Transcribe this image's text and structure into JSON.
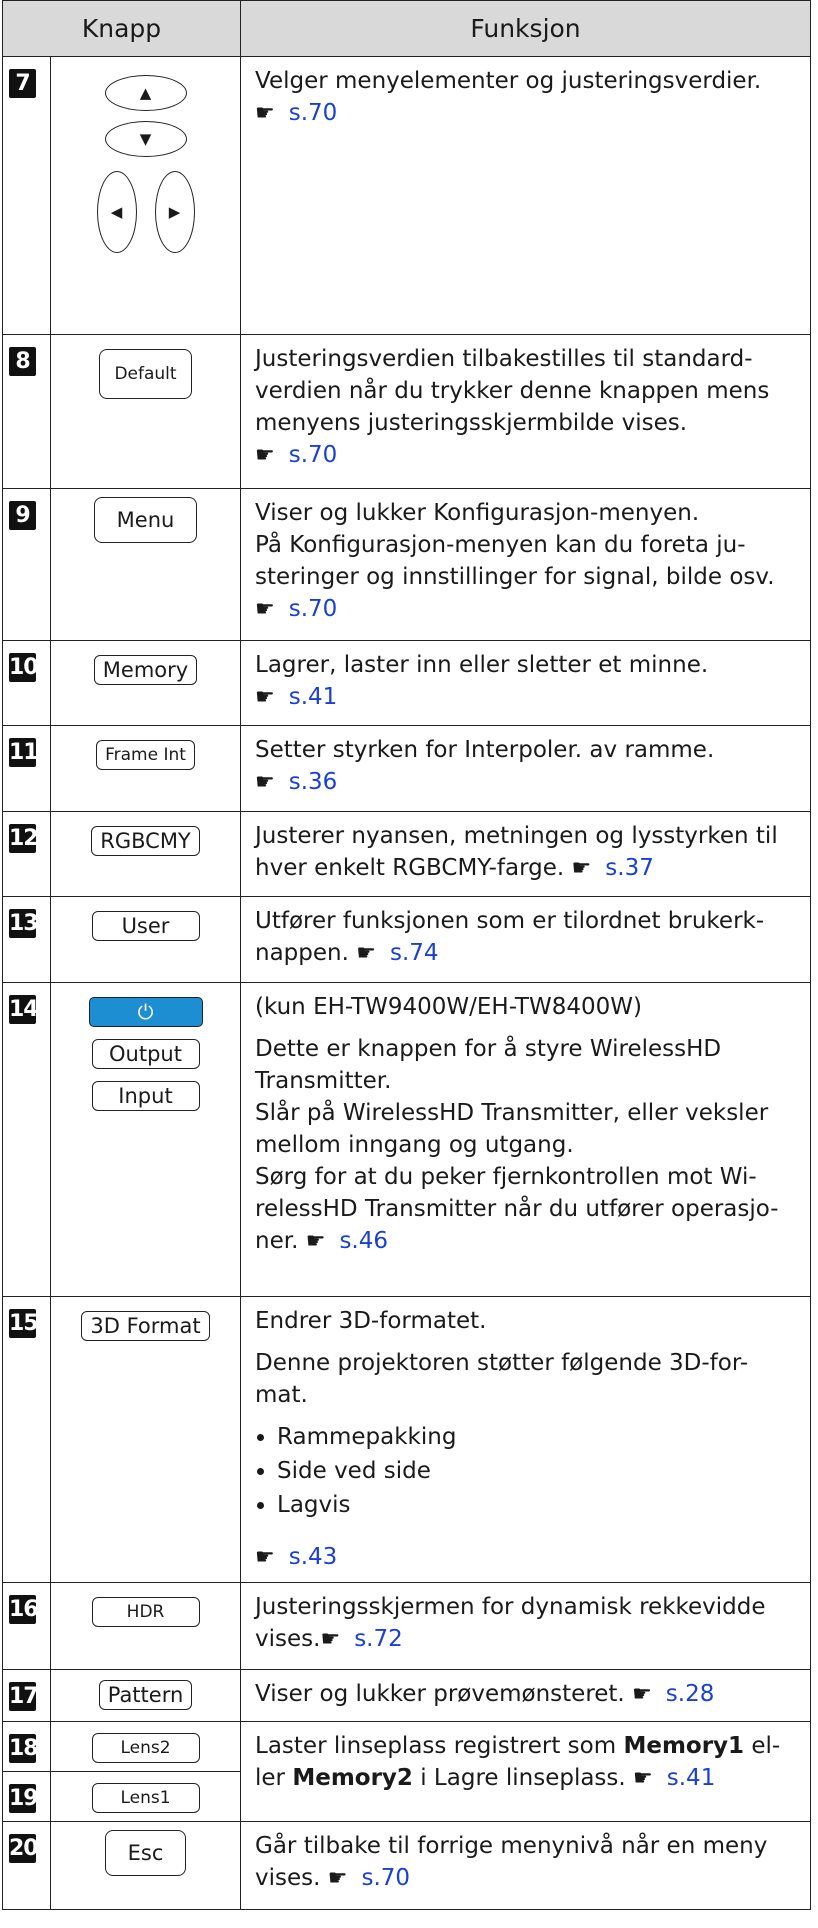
{
  "header": {
    "knapp": "Knapp",
    "funksjon": "Funksjon"
  },
  "hand": "☛",
  "rows": {
    "r7": {
      "num": "7",
      "up": "▲",
      "down": "▼",
      "left": "◀",
      "right": "▶",
      "text": "Velger menyelementer og justeringsverdier.",
      "link": "s.70"
    },
    "r8": {
      "num": "8",
      "key": "Default",
      "text": "Justeringsverdien tilbakestilles til standard-verdien når du trykker denne knappen mens menyens justeringsskjermbilde vises.",
      "link": "s.70"
    },
    "r9": {
      "num": "9",
      "key": "Menu",
      "line1": "Viser og lukker Konfigurasjon-menyen.",
      "line2": "På Konfigurasjon-menyen kan du foreta ju-steringer og innstillinger for signal, bilde osv.",
      "link": "s.70"
    },
    "r10": {
      "num": "10",
      "key": "Memory",
      "text": "Lagrer, laster inn eller sletter et minne.",
      "link": "s.41"
    },
    "r11": {
      "num": "11",
      "key": "Frame Int",
      "text": "Setter styrken for Interpoler. av ramme.",
      "link": "s.36"
    },
    "r12": {
      "num": "12",
      "key": "RGBCMY",
      "text": "Justerer nyansen, metningen og lysstyrken til hver enkelt RGBCMY-farge.",
      "link": "s.37"
    },
    "r13": {
      "num": "13",
      "key": "User",
      "text": "Utfører funksjonen som er tilordnet brukerk-nappen.",
      "link": "s.74"
    },
    "r14": {
      "num": "14",
      "power": "⏻",
      "output": "Output",
      "input": "Input",
      "p1": "(kun EH-TW9400W/EH-TW8400W)",
      "p2": "Dette er knappen for å styre WirelessHD Transmitter.",
      "p3": "Slår på WirelessHD Transmitter, eller veksler mellom inngang og utgang.",
      "p4": "Sørg for at du peker fjernkontrollen mot Wi-relessHD Transmitter når du utfører operasjo-ner.",
      "link": "s.46"
    },
    "r15": {
      "num": "15",
      "key": "3D Format",
      "p1": "Endrer 3D-formatet.",
      "p2": "Denne projektoren støtter følgende 3D-for-mat.",
      "items": [
        "Rammepakking",
        "Side ved side",
        "Lagvis"
      ],
      "link": "s.43"
    },
    "r16": {
      "num": "16",
      "key": "HDR",
      "text": "Justeringsskjermen for dynamisk rekkevidde vises.",
      "link": "s.72"
    },
    "r17": {
      "num": "17",
      "key": "Pattern",
      "text": "Viser og lukker prøvemønsteret.",
      "link": "s.28"
    },
    "r18": {
      "num": "18",
      "key": "Lens2",
      "t1": "Laster linseplass registrert som ",
      "b1": "Memory1",
      "t2": " el-ler ",
      "b2": "Memory2",
      "t3": " i Lagre linseplass.",
      "link": "s.41"
    },
    "r19": {
      "num": "19",
      "key": "Lens1"
    },
    "r20": {
      "num": "20",
      "key": "Esc",
      "text": "Går tilbake til forrige menynivå når en meny vises.",
      "link": "s.70"
    }
  }
}
